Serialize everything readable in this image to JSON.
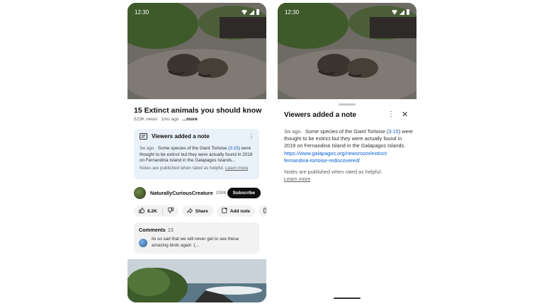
{
  "status": {
    "time": "12:30"
  },
  "video": {
    "title": "15 Extinct animals you should know",
    "views": "523K views",
    "age": "1mo ago",
    "more": "...more"
  },
  "note": {
    "heading": "Viewers added a note",
    "ago": "3w ago",
    "body_text": "Some species of the Giant Tortoise (",
    "timestamp": "3:15",
    "body_text2": ") were thought to be extinct but they were actually found in 2019 on Fernandina Island in the Galapagos Islands...",
    "footer_text": "Notes are published when rated as helpful.",
    "learn_more": "Learn more"
  },
  "channel": {
    "name": "NaturallyCuriousCreature",
    "subscribers": "200K",
    "subscribe_label": "Subscribe"
  },
  "actions": {
    "likes": "8.2K",
    "share": "Share",
    "add_note": "Add note",
    "save": "Sa"
  },
  "comments": {
    "label": "Comments",
    "count": "23",
    "top_comment": "its so sad that we will never get to see these amazing birds again :(..."
  },
  "sheet": {
    "title": "Viewers added a note",
    "ago": "3w ago",
    "body_text": "Some species of the Giant Tortoise (",
    "timestamp": "3:15",
    "body_text2": ") were thought to be extinct but they were actually found in 2019 on Fernandina Island in the Galapagos Islands. ",
    "url": "https://www.galapagos.org/newsroom/extinct-fernandina-tortoise-rediscovered/",
    "footer_text": "Notes are published when rated as helpful.",
    "learn_more": "Learn more"
  },
  "colors": {
    "link": "#065fd4",
    "note_background": "#e9f1fb",
    "subscribe_background": "#0f0f0f"
  }
}
